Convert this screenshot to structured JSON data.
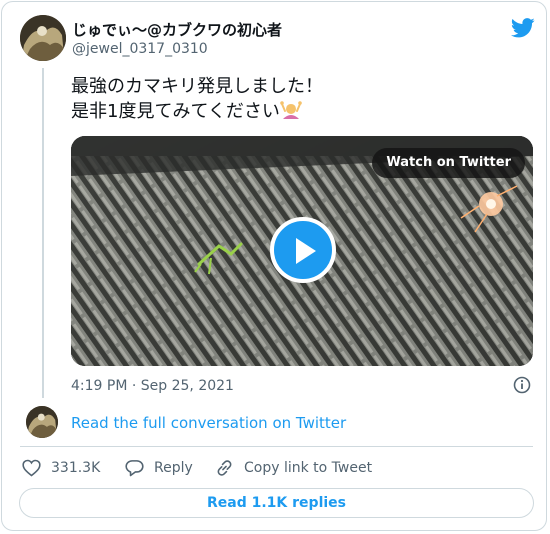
{
  "author": {
    "display_name": "じゅでぃ〜@カブクワの初心者",
    "handle": "@jewel_0317_0310"
  },
  "tweet": {
    "text": "最強のカマキリ発見しました！\n是非1度見てみてください",
    "emoji": "person-gesturing-ok",
    "timestamp": "4:19 PM · Sep 25, 2021"
  },
  "media": {
    "watch_label": "Watch on Twitter"
  },
  "conversation": {
    "link_label": "Read the full conversation on Twitter"
  },
  "actions": {
    "likes": "331.3K",
    "reply_label": "Reply",
    "copy_label": "Copy link to Tweet"
  },
  "replies_button": "Read 1.1K replies",
  "colors": {
    "accent": "#1d9bf0",
    "text": "#0f1419",
    "muted": "#536471",
    "border": "#cfd9de"
  }
}
